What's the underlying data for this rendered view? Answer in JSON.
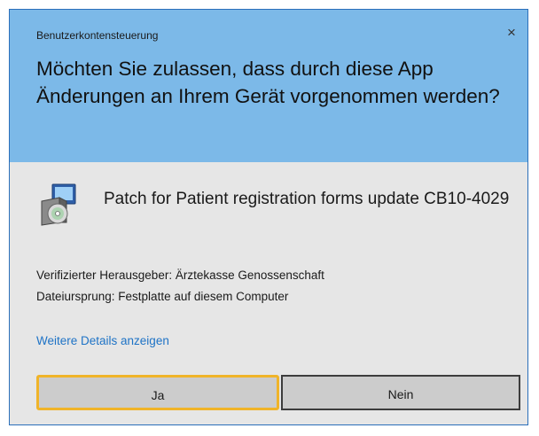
{
  "dialog": {
    "window_title": "Benutzerkontensteuerung",
    "close_glyph": "×",
    "question": "Möchten Sie zulassen, dass durch diese App Änderungen an Ihrem Gerät vorgenommen werden?",
    "app_icon": "installer-package-icon",
    "app_name": "Patch for Patient registration forms update CB10-4029",
    "publisher": "Verifizierter Herausgeber: Ärztekasse Genossenschaft",
    "origin": "Dateiursprung: Festplatte auf diesem Computer",
    "details_link": "Weitere Details anzeigen",
    "yes_label": "Ja",
    "no_label": "Nein"
  },
  "colors": {
    "header_bg": "#7cb9e8",
    "body_bg": "#e6e6e6",
    "link": "#1e73c6",
    "focus_highlight": "#f0b429"
  }
}
